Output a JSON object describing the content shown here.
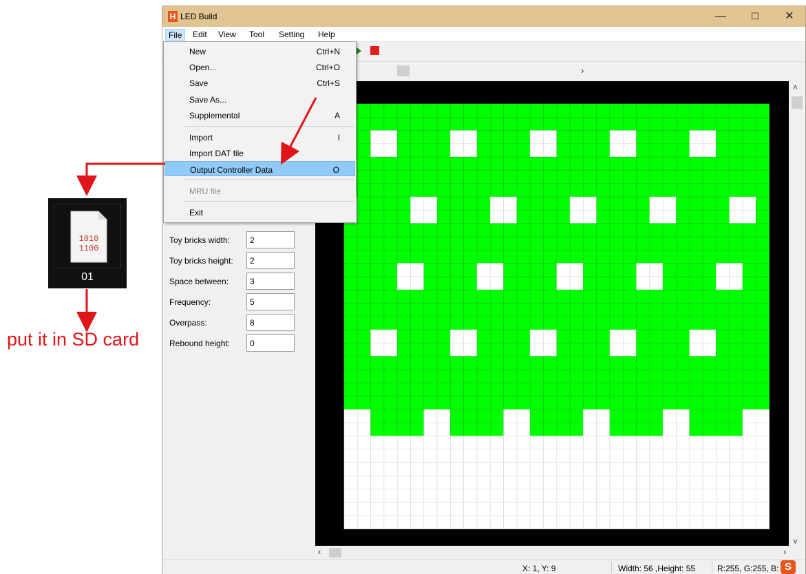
{
  "window": {
    "title": "LED Build",
    "minimize": "—",
    "maximize": "☐",
    "close": "✕"
  },
  "menubar": {
    "items": [
      "File",
      "Edit",
      "View",
      "Tool",
      "Setting",
      "Help"
    ],
    "active": "File"
  },
  "file_menu": {
    "items": [
      {
        "label": "New",
        "shortcut": "Ctrl+N"
      },
      {
        "label": "Open...",
        "shortcut": "Ctrl+O"
      },
      {
        "label": "Save",
        "shortcut": "Ctrl+S"
      },
      {
        "label": "Save As...",
        "shortcut": ""
      },
      {
        "label": "Supplemental",
        "shortcut": "A"
      },
      {
        "label": "Import",
        "shortcut": "I"
      },
      {
        "label": "Import DAT file",
        "shortcut": ""
      },
      {
        "label": "Output Controller Data",
        "shortcut": "O"
      },
      {
        "label": "MRU file",
        "shortcut": ""
      },
      {
        "label": "Exit",
        "shortcut": ""
      }
    ],
    "highlighted": "Output Controller Data"
  },
  "properties": [
    {
      "label": "Toy bricks width:",
      "value": "2"
    },
    {
      "label": "Toy bricks height:",
      "value": "2"
    },
    {
      "label": "Space between:",
      "value": "3"
    },
    {
      "label": "Frequency:",
      "value": "5"
    },
    {
      "label": "Overpass:",
      "value": "8"
    },
    {
      "label": "Rebound height:",
      "value": "0"
    }
  ],
  "status": {
    "coords": "X: 1, Y: 9",
    "size": "Width: 56 ,Height: 55",
    "color": "R:255, G:255, B:"
  },
  "file_tile": {
    "icon_text_line1": "1010",
    "icon_text_line2": "1100",
    "name": "01"
  },
  "annotation": "put it in SD card",
  "colors": {
    "titlebar": "#e0c491",
    "led_green": "#00ff00",
    "led_white": "#ffffff",
    "arrow_red": "#e0151a",
    "menu_highlight": "#91c9f7"
  },
  "icons": {
    "app": "app-logo-icon",
    "run": "play-icon",
    "stop": "stop-icon",
    "file": "binary-file-icon",
    "arrow": "red-arrow-icon"
  }
}
